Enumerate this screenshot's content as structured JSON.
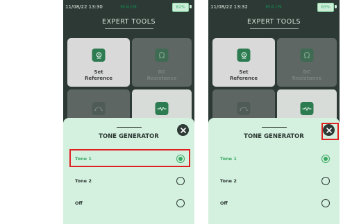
{
  "screens": [
    {
      "status": {
        "time": "11/08/22 13:30",
        "mode": "MAIN",
        "battery": "82%"
      },
      "title": "EXPERT TOOLS",
      "tiles": [
        {
          "label_line1": "Set",
          "label_line2": "Reference"
        },
        {
          "label_line1": "DC",
          "label_line2": "Resistance"
        }
      ],
      "sheet": {
        "title": "TONE GENERATOR",
        "options": [
          "Tone 1",
          "Tone 2",
          "Off"
        ],
        "selected": "Tone 1"
      }
    },
    {
      "status": {
        "time": "11/08/22 13:32",
        "mode": "MAIN",
        "battery": "83%"
      },
      "title": "EXPERT TOOLS",
      "tiles": [
        {
          "label_line1": "Set",
          "label_line2": "Reference"
        },
        {
          "label_line1": "DC",
          "label_line2": "Resistance"
        }
      ],
      "sheet": {
        "title": "TONE GENERATOR",
        "options": [
          "Tone 1",
          "Tone 2",
          "Off"
        ],
        "selected": "Tone 1"
      }
    }
  ],
  "colors": {
    "screen_bg": "#2c3934",
    "sheet_bg": "#d4f1e0",
    "accent_green": "#3aa862",
    "highlight_red": "#e02020"
  }
}
